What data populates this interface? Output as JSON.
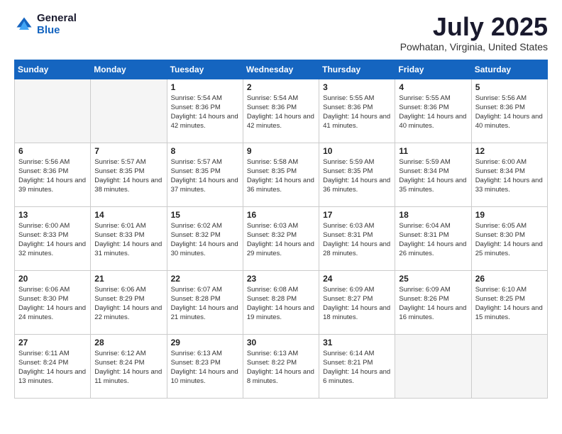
{
  "logo": {
    "general": "General",
    "blue": "Blue"
  },
  "header": {
    "month": "July 2025",
    "location": "Powhatan, Virginia, United States"
  },
  "weekdays": [
    "Sunday",
    "Monday",
    "Tuesday",
    "Wednesday",
    "Thursday",
    "Friday",
    "Saturday"
  ],
  "weeks": [
    [
      {
        "day": "",
        "info": ""
      },
      {
        "day": "",
        "info": ""
      },
      {
        "day": "1",
        "info": "Sunrise: 5:54 AM\nSunset: 8:36 PM\nDaylight: 14 hours and 42 minutes."
      },
      {
        "day": "2",
        "info": "Sunrise: 5:54 AM\nSunset: 8:36 PM\nDaylight: 14 hours and 42 minutes."
      },
      {
        "day": "3",
        "info": "Sunrise: 5:55 AM\nSunset: 8:36 PM\nDaylight: 14 hours and 41 minutes."
      },
      {
        "day": "4",
        "info": "Sunrise: 5:55 AM\nSunset: 8:36 PM\nDaylight: 14 hours and 40 minutes."
      },
      {
        "day": "5",
        "info": "Sunrise: 5:56 AM\nSunset: 8:36 PM\nDaylight: 14 hours and 40 minutes."
      }
    ],
    [
      {
        "day": "6",
        "info": "Sunrise: 5:56 AM\nSunset: 8:36 PM\nDaylight: 14 hours and 39 minutes."
      },
      {
        "day": "7",
        "info": "Sunrise: 5:57 AM\nSunset: 8:35 PM\nDaylight: 14 hours and 38 minutes."
      },
      {
        "day": "8",
        "info": "Sunrise: 5:57 AM\nSunset: 8:35 PM\nDaylight: 14 hours and 37 minutes."
      },
      {
        "day": "9",
        "info": "Sunrise: 5:58 AM\nSunset: 8:35 PM\nDaylight: 14 hours and 36 minutes."
      },
      {
        "day": "10",
        "info": "Sunrise: 5:59 AM\nSunset: 8:35 PM\nDaylight: 14 hours and 36 minutes."
      },
      {
        "day": "11",
        "info": "Sunrise: 5:59 AM\nSunset: 8:34 PM\nDaylight: 14 hours and 35 minutes."
      },
      {
        "day": "12",
        "info": "Sunrise: 6:00 AM\nSunset: 8:34 PM\nDaylight: 14 hours and 33 minutes."
      }
    ],
    [
      {
        "day": "13",
        "info": "Sunrise: 6:00 AM\nSunset: 8:33 PM\nDaylight: 14 hours and 32 minutes."
      },
      {
        "day": "14",
        "info": "Sunrise: 6:01 AM\nSunset: 8:33 PM\nDaylight: 14 hours and 31 minutes."
      },
      {
        "day": "15",
        "info": "Sunrise: 6:02 AM\nSunset: 8:32 PM\nDaylight: 14 hours and 30 minutes."
      },
      {
        "day": "16",
        "info": "Sunrise: 6:03 AM\nSunset: 8:32 PM\nDaylight: 14 hours and 29 minutes."
      },
      {
        "day": "17",
        "info": "Sunrise: 6:03 AM\nSunset: 8:31 PM\nDaylight: 14 hours and 28 minutes."
      },
      {
        "day": "18",
        "info": "Sunrise: 6:04 AM\nSunset: 8:31 PM\nDaylight: 14 hours and 26 minutes."
      },
      {
        "day": "19",
        "info": "Sunrise: 6:05 AM\nSunset: 8:30 PM\nDaylight: 14 hours and 25 minutes."
      }
    ],
    [
      {
        "day": "20",
        "info": "Sunrise: 6:06 AM\nSunset: 8:30 PM\nDaylight: 14 hours and 24 minutes."
      },
      {
        "day": "21",
        "info": "Sunrise: 6:06 AM\nSunset: 8:29 PM\nDaylight: 14 hours and 22 minutes."
      },
      {
        "day": "22",
        "info": "Sunrise: 6:07 AM\nSunset: 8:28 PM\nDaylight: 14 hours and 21 minutes."
      },
      {
        "day": "23",
        "info": "Sunrise: 6:08 AM\nSunset: 8:28 PM\nDaylight: 14 hours and 19 minutes."
      },
      {
        "day": "24",
        "info": "Sunrise: 6:09 AM\nSunset: 8:27 PM\nDaylight: 14 hours and 18 minutes."
      },
      {
        "day": "25",
        "info": "Sunrise: 6:09 AM\nSunset: 8:26 PM\nDaylight: 14 hours and 16 minutes."
      },
      {
        "day": "26",
        "info": "Sunrise: 6:10 AM\nSunset: 8:25 PM\nDaylight: 14 hours and 15 minutes."
      }
    ],
    [
      {
        "day": "27",
        "info": "Sunrise: 6:11 AM\nSunset: 8:24 PM\nDaylight: 14 hours and 13 minutes."
      },
      {
        "day": "28",
        "info": "Sunrise: 6:12 AM\nSunset: 8:24 PM\nDaylight: 14 hours and 11 minutes."
      },
      {
        "day": "29",
        "info": "Sunrise: 6:13 AM\nSunset: 8:23 PM\nDaylight: 14 hours and 10 minutes."
      },
      {
        "day": "30",
        "info": "Sunrise: 6:13 AM\nSunset: 8:22 PM\nDaylight: 14 hours and 8 minutes."
      },
      {
        "day": "31",
        "info": "Sunrise: 6:14 AM\nSunset: 8:21 PM\nDaylight: 14 hours and 6 minutes."
      },
      {
        "day": "",
        "info": ""
      },
      {
        "day": "",
        "info": ""
      }
    ]
  ]
}
